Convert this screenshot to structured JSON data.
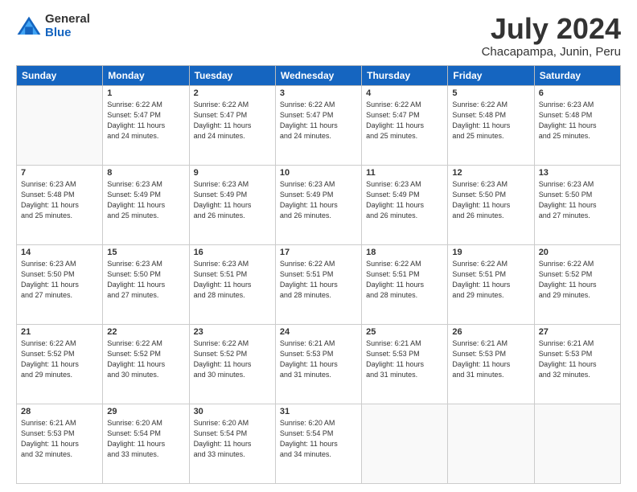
{
  "logo": {
    "general": "General",
    "blue": "Blue"
  },
  "title": "July 2024",
  "subtitle": "Chacapampa, Junin, Peru",
  "days_of_week": [
    "Sunday",
    "Monday",
    "Tuesday",
    "Wednesday",
    "Thursday",
    "Friday",
    "Saturday"
  ],
  "weeks": [
    [
      {
        "num": "",
        "info": ""
      },
      {
        "num": "1",
        "info": "Sunrise: 6:22 AM\nSunset: 5:47 PM\nDaylight: 11 hours\nand 24 minutes."
      },
      {
        "num": "2",
        "info": "Sunrise: 6:22 AM\nSunset: 5:47 PM\nDaylight: 11 hours\nand 24 minutes."
      },
      {
        "num": "3",
        "info": "Sunrise: 6:22 AM\nSunset: 5:47 PM\nDaylight: 11 hours\nand 24 minutes."
      },
      {
        "num": "4",
        "info": "Sunrise: 6:22 AM\nSunset: 5:47 PM\nDaylight: 11 hours\nand 25 minutes."
      },
      {
        "num": "5",
        "info": "Sunrise: 6:22 AM\nSunset: 5:48 PM\nDaylight: 11 hours\nand 25 minutes."
      },
      {
        "num": "6",
        "info": "Sunrise: 6:23 AM\nSunset: 5:48 PM\nDaylight: 11 hours\nand 25 minutes."
      }
    ],
    [
      {
        "num": "7",
        "info": "Sunrise: 6:23 AM\nSunset: 5:48 PM\nDaylight: 11 hours\nand 25 minutes."
      },
      {
        "num": "8",
        "info": "Sunrise: 6:23 AM\nSunset: 5:49 PM\nDaylight: 11 hours\nand 25 minutes."
      },
      {
        "num": "9",
        "info": "Sunrise: 6:23 AM\nSunset: 5:49 PM\nDaylight: 11 hours\nand 26 minutes."
      },
      {
        "num": "10",
        "info": "Sunrise: 6:23 AM\nSunset: 5:49 PM\nDaylight: 11 hours\nand 26 minutes."
      },
      {
        "num": "11",
        "info": "Sunrise: 6:23 AM\nSunset: 5:49 PM\nDaylight: 11 hours\nand 26 minutes."
      },
      {
        "num": "12",
        "info": "Sunrise: 6:23 AM\nSunset: 5:50 PM\nDaylight: 11 hours\nand 26 minutes."
      },
      {
        "num": "13",
        "info": "Sunrise: 6:23 AM\nSunset: 5:50 PM\nDaylight: 11 hours\nand 27 minutes."
      }
    ],
    [
      {
        "num": "14",
        "info": "Sunrise: 6:23 AM\nSunset: 5:50 PM\nDaylight: 11 hours\nand 27 minutes."
      },
      {
        "num": "15",
        "info": "Sunrise: 6:23 AM\nSunset: 5:50 PM\nDaylight: 11 hours\nand 27 minutes."
      },
      {
        "num": "16",
        "info": "Sunrise: 6:23 AM\nSunset: 5:51 PM\nDaylight: 11 hours\nand 28 minutes."
      },
      {
        "num": "17",
        "info": "Sunrise: 6:22 AM\nSunset: 5:51 PM\nDaylight: 11 hours\nand 28 minutes."
      },
      {
        "num": "18",
        "info": "Sunrise: 6:22 AM\nSunset: 5:51 PM\nDaylight: 11 hours\nand 28 minutes."
      },
      {
        "num": "19",
        "info": "Sunrise: 6:22 AM\nSunset: 5:51 PM\nDaylight: 11 hours\nand 29 minutes."
      },
      {
        "num": "20",
        "info": "Sunrise: 6:22 AM\nSunset: 5:52 PM\nDaylight: 11 hours\nand 29 minutes."
      }
    ],
    [
      {
        "num": "21",
        "info": "Sunrise: 6:22 AM\nSunset: 5:52 PM\nDaylight: 11 hours\nand 29 minutes."
      },
      {
        "num": "22",
        "info": "Sunrise: 6:22 AM\nSunset: 5:52 PM\nDaylight: 11 hours\nand 30 minutes."
      },
      {
        "num": "23",
        "info": "Sunrise: 6:22 AM\nSunset: 5:52 PM\nDaylight: 11 hours\nand 30 minutes."
      },
      {
        "num": "24",
        "info": "Sunrise: 6:21 AM\nSunset: 5:53 PM\nDaylight: 11 hours\nand 31 minutes."
      },
      {
        "num": "25",
        "info": "Sunrise: 6:21 AM\nSunset: 5:53 PM\nDaylight: 11 hours\nand 31 minutes."
      },
      {
        "num": "26",
        "info": "Sunrise: 6:21 AM\nSunset: 5:53 PM\nDaylight: 11 hours\nand 31 minutes."
      },
      {
        "num": "27",
        "info": "Sunrise: 6:21 AM\nSunset: 5:53 PM\nDaylight: 11 hours\nand 32 minutes."
      }
    ],
    [
      {
        "num": "28",
        "info": "Sunrise: 6:21 AM\nSunset: 5:53 PM\nDaylight: 11 hours\nand 32 minutes."
      },
      {
        "num": "29",
        "info": "Sunrise: 6:20 AM\nSunset: 5:54 PM\nDaylight: 11 hours\nand 33 minutes."
      },
      {
        "num": "30",
        "info": "Sunrise: 6:20 AM\nSunset: 5:54 PM\nDaylight: 11 hours\nand 33 minutes."
      },
      {
        "num": "31",
        "info": "Sunrise: 6:20 AM\nSunset: 5:54 PM\nDaylight: 11 hours\nand 34 minutes."
      },
      {
        "num": "",
        "info": ""
      },
      {
        "num": "",
        "info": ""
      },
      {
        "num": "",
        "info": ""
      }
    ]
  ]
}
